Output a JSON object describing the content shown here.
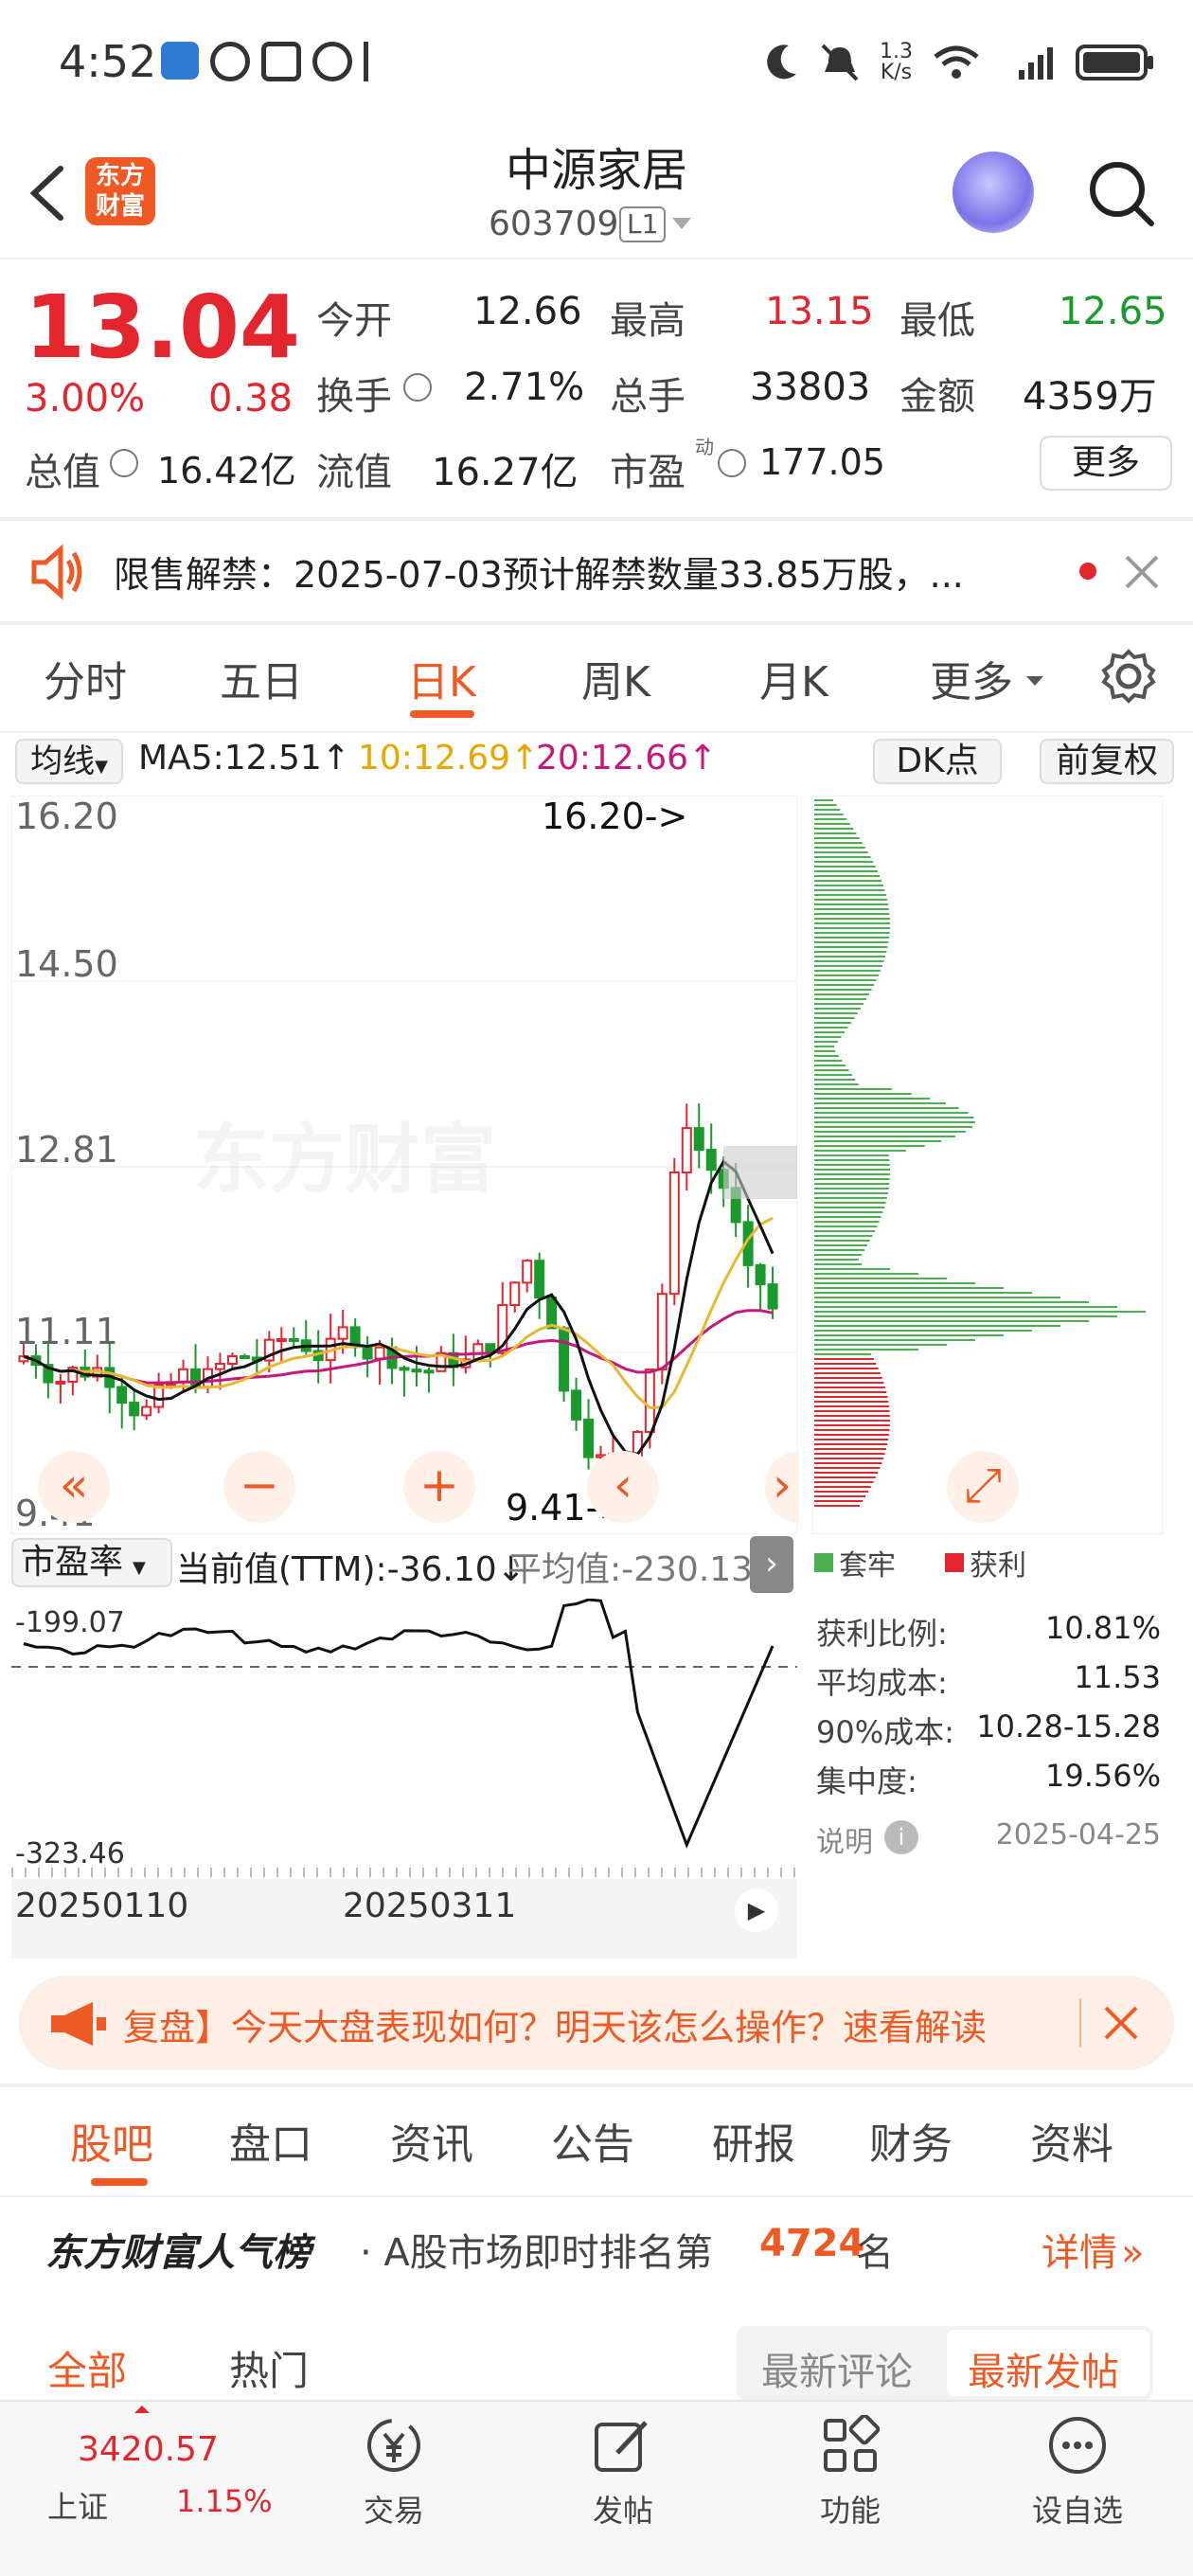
{
  "status_bar": {
    "time": "4:52",
    "network_speed_value": "1.3",
    "network_speed_unit": "K/s"
  },
  "header": {
    "logo_line1": "东方",
    "logo_line2": "财富",
    "title": "中源家居",
    "code": "603709",
    "badge": "L1"
  },
  "quote": {
    "price": "13.04",
    "change_pct": "3.00%",
    "change": "0.38",
    "open_label": "今开",
    "open": "12.66",
    "high_label": "最高",
    "high": "13.15",
    "low_label": "最低",
    "low": "12.65",
    "turnover_label": "换手",
    "turnover": "2.71%",
    "volume_label": "总手",
    "volume": "33803",
    "amount_label": "金额",
    "amount": "4359万",
    "mktcap_label": "总值",
    "mktcap": "16.42亿",
    "float_label": "流值",
    "float_cap": "16.27亿",
    "pe_label": "市盈",
    "pe_sup": "动",
    "pe": "177.05",
    "more": "更多"
  },
  "notice": {
    "text": "限售解禁：2025-07-03预计解禁数量33.85万股，..."
  },
  "tabs": [
    "分时",
    "五日",
    "日K",
    "周K",
    "月K",
    "更多"
  ],
  "chart_toolbar": {
    "ma_select": "均线",
    "ma5": "MA5:12.51↑",
    "ma10": "10:12.69↑",
    "ma20": "20:12.66↑",
    "dk": "DK点",
    "adjust": "前复权"
  },
  "kline": {
    "y_labels": [
      "16.20",
      "14.50",
      "12.81",
      "11.11",
      "9.41"
    ],
    "max_annot": "16.20->",
    "min_annot": "9.41->",
    "watermark": "东方财富"
  },
  "indicator": {
    "select": "市盈率",
    "current": "当前值(TTM):-36.10↓",
    "avg": "平均值:-230.13",
    "top": "-199.07",
    "bottom": "-323.46"
  },
  "x_axis": [
    "20250110",
    "20250311"
  ],
  "chip": {
    "legend_trapped": "套牢",
    "legend_profit": "获利",
    "rows": [
      {
        "label": "获利比例:",
        "value": "10.81%"
      },
      {
        "label": "平均成本:",
        "value": "11.53"
      },
      {
        "label": "90%成本:",
        "value": "10.28-15.28"
      },
      {
        "label": "集中度:",
        "value": "19.56%"
      }
    ],
    "note": "说明",
    "date": "2025-04-25"
  },
  "colors": {
    "up": "#e3262e",
    "down": "#1a9a2d",
    "accent": "#ef5a24"
  },
  "promo": {
    "text": "复盘】今天大盘表现如何？明天该怎么操作？速看解读"
  },
  "bottom_tabs": [
    "股吧",
    "盘口",
    "资讯",
    "公告",
    "研报",
    "财务",
    "资料"
  ],
  "rank": {
    "title": "东方财富人气榜",
    "prefix": "· A股市场即时排名第",
    "number": "4724",
    "suffix": "名",
    "detail": "详情"
  },
  "sub_tabs": {
    "all": "全部",
    "hot": "热门",
    "latest_comment": "最新评论",
    "latest_post": "最新发帖"
  },
  "nav": {
    "index_value": "3420.57",
    "index_name": "上证",
    "index_pct": "1.15%",
    "trade": "交易",
    "post": "发帖",
    "func": "功能",
    "watch": "设自选"
  }
}
